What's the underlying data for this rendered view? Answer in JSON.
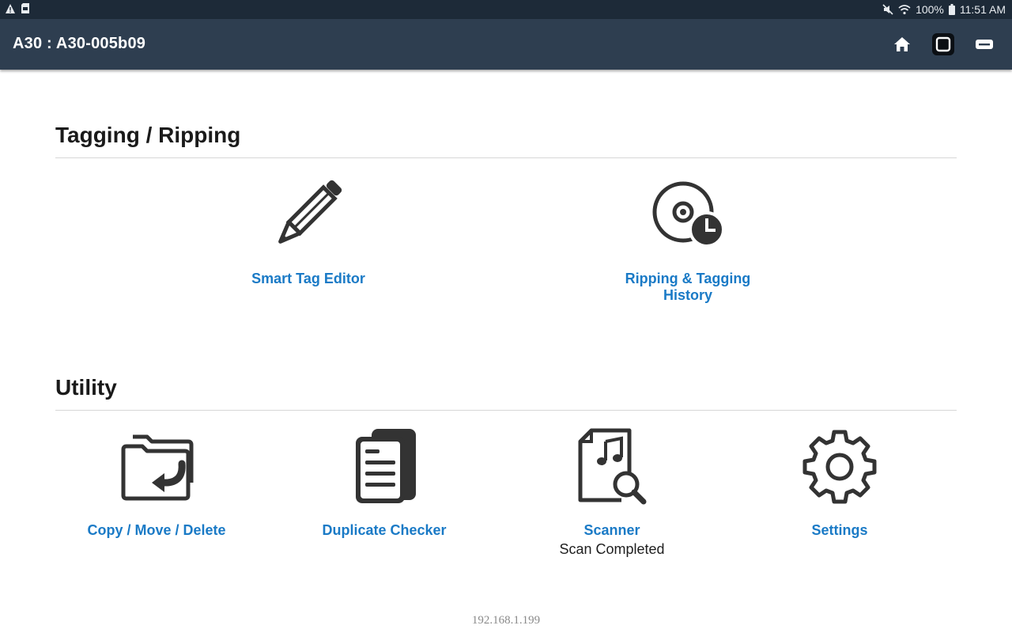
{
  "status_bar": {
    "battery": "100%",
    "time": "11:51 AM"
  },
  "app_bar": {
    "title": "A30 : A30-005b09",
    "actions": [
      "home-icon",
      "stop-icon",
      "remote-icon"
    ]
  },
  "sections": [
    {
      "title": "Tagging / Ripping",
      "items": [
        {
          "label": "Smart Tag Editor",
          "icon": "pencil-icon"
        },
        {
          "label_line1": "Ripping & Tagging",
          "label_line2": "History",
          "icon": "disc-history-icon"
        }
      ]
    },
    {
      "title": "Utility",
      "items": [
        {
          "label": "Copy / Move / Delete",
          "icon": "folder-move-icon"
        },
        {
          "label": "Duplicate Checker",
          "icon": "duplicate-document-icon"
        },
        {
          "label": "Scanner",
          "status": "Scan Completed",
          "icon": "music-file-search-icon"
        },
        {
          "label": "Settings",
          "icon": "gear-icon"
        }
      ]
    }
  ],
  "footer": {
    "ip_address": "192.168.1.199"
  }
}
